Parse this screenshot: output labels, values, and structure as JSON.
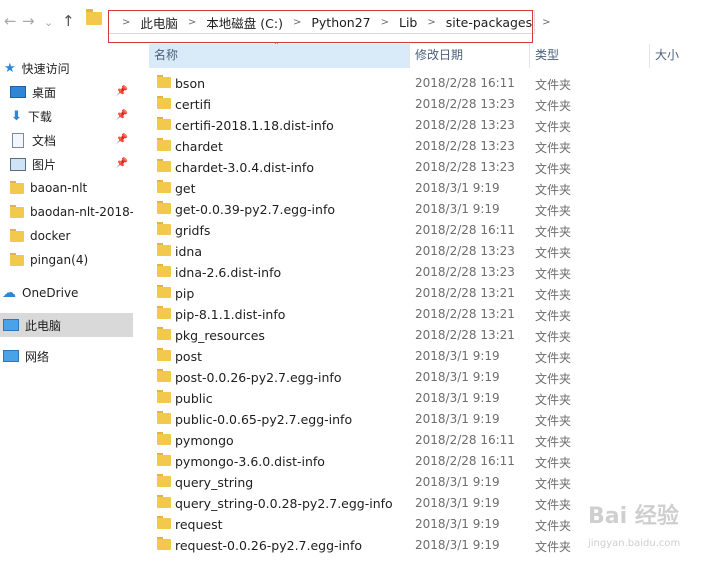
{
  "nav": {
    "back": "←",
    "forward": "→",
    "recent": "⌄",
    "up": "↑"
  },
  "address": {
    "crumbs": [
      "此电脑",
      "本地磁盘 (C:)",
      "Python27",
      "Lib",
      "site-packages"
    ]
  },
  "columns": {
    "name": "名称",
    "date": "修改日期",
    "type": "类型",
    "size": "大小"
  },
  "sidebar": {
    "quick_access": "快速访问",
    "items": [
      {
        "label": "桌面"
      },
      {
        "label": "下载"
      },
      {
        "label": "文档"
      },
      {
        "label": "图片"
      },
      {
        "label": "baoan-nlt"
      },
      {
        "label": "baodan-nlt-2018-"
      },
      {
        "label": "docker"
      },
      {
        "label": "pingan(4)"
      }
    ],
    "onedrive": "OneDrive",
    "this_pc": "此电脑",
    "network": "网络"
  },
  "files": [
    {
      "name": "bson",
      "date": "2018/2/28 16:11",
      "type": "文件夹"
    },
    {
      "name": "certifi",
      "date": "2018/2/28 13:23",
      "type": "文件夹"
    },
    {
      "name": "certifi-2018.1.18.dist-info",
      "date": "2018/2/28 13:23",
      "type": "文件夹"
    },
    {
      "name": "chardet",
      "date": "2018/2/28 13:23",
      "type": "文件夹"
    },
    {
      "name": "chardet-3.0.4.dist-info",
      "date": "2018/2/28 13:23",
      "type": "文件夹"
    },
    {
      "name": "get",
      "date": "2018/3/1 9:19",
      "type": "文件夹"
    },
    {
      "name": "get-0.0.39-py2.7.egg-info",
      "date": "2018/3/1 9:19",
      "type": "文件夹"
    },
    {
      "name": "gridfs",
      "date": "2018/2/28 16:11",
      "type": "文件夹"
    },
    {
      "name": "idna",
      "date": "2018/2/28 13:23",
      "type": "文件夹"
    },
    {
      "name": "idna-2.6.dist-info",
      "date": "2018/2/28 13:23",
      "type": "文件夹"
    },
    {
      "name": "pip",
      "date": "2018/2/28 13:21",
      "type": "文件夹"
    },
    {
      "name": "pip-8.1.1.dist-info",
      "date": "2018/2/28 13:21",
      "type": "文件夹"
    },
    {
      "name": "pkg_resources",
      "date": "2018/2/28 13:21",
      "type": "文件夹"
    },
    {
      "name": "post",
      "date": "2018/3/1 9:19",
      "type": "文件夹"
    },
    {
      "name": "post-0.0.26-py2.7.egg-info",
      "date": "2018/3/1 9:19",
      "type": "文件夹"
    },
    {
      "name": "public",
      "date": "2018/3/1 9:19",
      "type": "文件夹"
    },
    {
      "name": "public-0.0.65-py2.7.egg-info",
      "date": "2018/3/1 9:19",
      "type": "文件夹"
    },
    {
      "name": "pymongo",
      "date": "2018/2/28 16:11",
      "type": "文件夹"
    },
    {
      "name": "pymongo-3.6.0.dist-info",
      "date": "2018/2/28 16:11",
      "type": "文件夹"
    },
    {
      "name": "query_string",
      "date": "2018/3/1 9:19",
      "type": "文件夹"
    },
    {
      "name": "query_string-0.0.28-py2.7.egg-info",
      "date": "2018/3/1 9:19",
      "type": "文件夹"
    },
    {
      "name": "request",
      "date": "2018/3/1 9:19",
      "type": "文件夹"
    },
    {
      "name": "request-0.0.26-py2.7.egg-info",
      "date": "2018/3/1 9:19",
      "type": "文件夹"
    }
  ],
  "watermark": {
    "text": "Bai 经验",
    "url": "jingyan.baidu.com"
  }
}
